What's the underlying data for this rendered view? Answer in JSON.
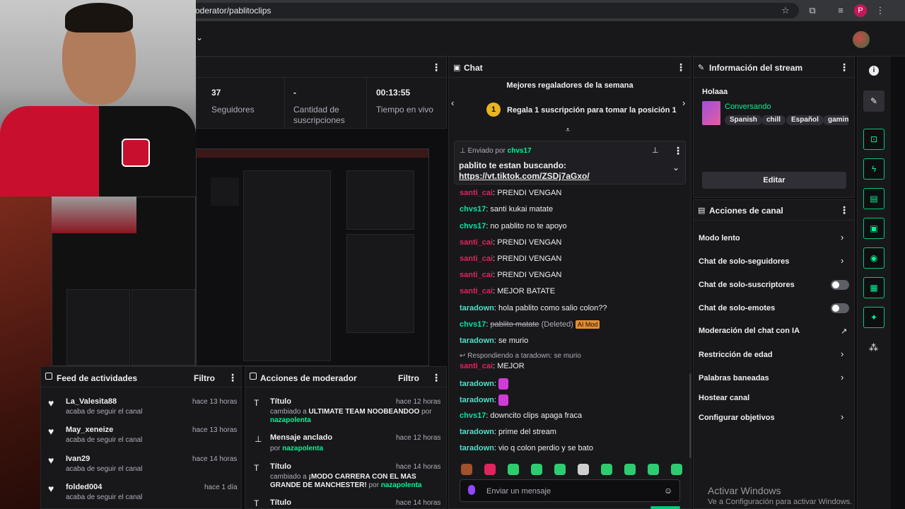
{
  "browser": {
    "url": "oderator/pablitoclips",
    "profile_initial": "P"
  },
  "stats": [
    {
      "value": "37",
      "label": "Seguidores"
    },
    {
      "value": "-",
      "label_line1": "Cantidad de",
      "label_line2": "suscripciones"
    },
    {
      "value": "00:13:55",
      "label": "Tiempo en vivo"
    }
  ],
  "chat": {
    "title": "Chat",
    "gifters_title": "Mejores regaladores de la semana",
    "gifter_rank": "1",
    "gifter_text": "Regala 1 suscripción para tomar la posición 1",
    "pinned_label": "Enviado por",
    "pinned_user": "chvs17",
    "pinned_msg": "pablito te estan buscando:",
    "pinned_link": "https://vt.tiktok.com/ZSDj7aGxo/",
    "messages": [
      {
        "user": "santi_cai",
        "color": "red",
        "text": ": PRENDI VENGAN"
      },
      {
        "user": "chvs17",
        "color": "green",
        "text": ": santi kukai matate"
      },
      {
        "user": "chvs17",
        "color": "green",
        "text": ": no pablito no te apoyo"
      },
      {
        "user": "santi_cai",
        "color": "red",
        "text": ": PRENDI VENGAN"
      },
      {
        "user": "santi_cai",
        "color": "red",
        "text": ": PRENDI VENGAN"
      },
      {
        "user": "santi_cai",
        "color": "red",
        "text": ": PRENDI VENGAN"
      },
      {
        "user": "santi_cai",
        "color": "red",
        "text": ": MEJOR BATATE"
      },
      {
        "user": "taradown",
        "color": "teal",
        "text": ": hola pablito como salio colon??"
      }
    ],
    "deleted_user": "chvs17",
    "deleted_text": "pablito matate",
    "deleted_tag": "(Deleted)",
    "mod_badge": "AI Mod",
    "msg_se_murio_user": "taradown",
    "msg_se_murio_text": ": se murio",
    "reply_label": "Respondiendo a taradown: se murio",
    "msg_mejor_user": "santi_cai",
    "msg_mejor_text": ": MEJOR",
    "emote_user1": "taradown",
    "emote_user2": "taradown",
    "msg_downcito_user": "chvs17",
    "msg_downcito_text": ": downcito clips apaga fraca",
    "msg_prime_user": "taradown",
    "msg_prime_text": ": prime del stream",
    "msg_vio_user": "taradown",
    "msg_vio_text": ": vio q colon perdio y se bato",
    "input_placeholder": "Enviar un mensaje"
  },
  "stream_info": {
    "title": "Información del stream",
    "stream_title": "Holaaa",
    "category": "Conversando",
    "tags": [
      "Spanish",
      "chill",
      "Español",
      "gamin"
    ],
    "edit_label": "Editar"
  },
  "channel_actions": {
    "title": "Acciones de canal",
    "items": [
      "Modo lento",
      "Chat de solo-seguidores",
      "Chat de solo-suscriptores",
      "Chat de solo-emotes",
      "Moderación del chat con IA",
      "Restricción de edad",
      "Palabras baneadas",
      "Hostear canal",
      "Configurar objetivos"
    ]
  },
  "activity_feed": {
    "title": "Feed de actividades",
    "filter": "Filtro",
    "items": [
      {
        "name": "La_Valesita88",
        "sub": "acaba de seguir el canal",
        "time": "hace 13 horas"
      },
      {
        "name": "May_xeneize",
        "sub": "acaba de seguir el canal",
        "time": "hace 13 horas"
      },
      {
        "name": "Ivan29",
        "sub": "acaba de seguir el canal",
        "time": "hace 14 horas"
      },
      {
        "name": "folded004",
        "sub": "acaba de seguir el canal",
        "time": "hace 1 día"
      }
    ]
  },
  "mod_actions": {
    "title": "Acciones de moderador",
    "filter": "Filtro",
    "items": [
      {
        "title": "Título",
        "line1_prefix": "cambiado a ",
        "line1_value": "ULTIMATE TEAM NOOBEANDOO",
        "line1_suffix": " por",
        "by": "nazapolenta",
        "time": "hace 12 horas"
      },
      {
        "title": "Mensaje anclado",
        "line1_prefix": "por ",
        "by": "nazapolenta",
        "time": "hace 12 horas"
      },
      {
        "title": "Título",
        "line1_prefix": "cambiado a ",
        "line1_value": "¡MODO CARRERA CON EL MAS",
        "line2_value": "GRANDE DE MANCHESTER!",
        "by_prefix": " por ",
        "by": "nazapolenta",
        "time": "hace 14 horas"
      },
      {
        "title": "Título",
        "time": "hace 14 horas"
      }
    ]
  },
  "watermark": {
    "line1": "Activar Windows",
    "line2": "Ve a Configuración para activar Windows."
  },
  "colors": {
    "accent": "#00f593",
    "background": "#0e0e10",
    "panel": "#18181b",
    "user_red": "#e0245e"
  }
}
